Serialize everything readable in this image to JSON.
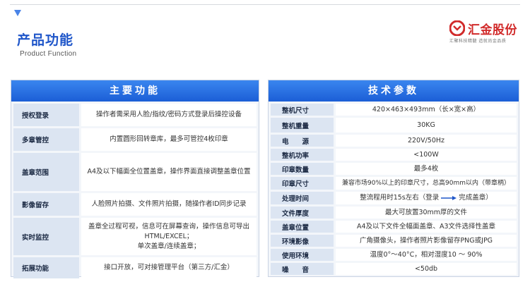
{
  "header": {
    "title": "产品功能",
    "subtitle": "Product Function"
  },
  "logo": {
    "name": "汇金股份",
    "tagline": "汇聚科技精髓   造就尚金品质"
  },
  "main_functions": {
    "heading": "主要功能",
    "rows": [
      {
        "label": "授权登录",
        "lines": [
          "操作者需采用人脸/指纹/密码方式登录后操控设备"
        ]
      },
      {
        "label": "多章管控",
        "lines": [
          "内置圆形回转章库，最多可管控4枚印章"
        ]
      },
      {
        "label": "盖章范围",
        "lines": [
          "A4及以下幅面全位置盖章，操作界面直接调整盖章位置"
        ]
      },
      {
        "label": "影像留存",
        "lines": [
          "人脸照片拍摄、文件照片拍摄，随操作者ID同步记录"
        ]
      },
      {
        "label": "实时监控",
        "lines": [
          "盖章全过程可视，信息可在屏幕查询，操作信息可导出",
          "HTML/EXCEL；",
          "单次盖章/连续盖章；"
        ]
      },
      {
        "label": "拓展功能",
        "lines": [
          "接口开放，可对接管理平台（第三方/汇金）"
        ]
      }
    ]
  },
  "tech_params": {
    "heading": "技术参数",
    "rows": [
      {
        "label": "整机尺寸",
        "value": "420×463×493mm（长×宽×高）"
      },
      {
        "label": "整机重量",
        "value": "30KG"
      },
      {
        "label": "电　　源",
        "value": "220V/50Hz"
      },
      {
        "label": "整机功率",
        "value": "<100W"
      },
      {
        "label": "印章数量",
        "value": "最多4枚"
      },
      {
        "label": "印章尺寸",
        "value": "兼容市场90%以上的印章尺寸，总高90mm以内（带章柄）"
      },
      {
        "label": "处理时间",
        "value_before": "整流程用时15s左右（登录",
        "value_after": "完成盖章）"
      },
      {
        "label": "文件厚度",
        "value": "最大可放置30mm厚的文件"
      },
      {
        "label": "盖章位置",
        "value": "A4及以下文件全幅面盖章、A3文件选择性盖章"
      },
      {
        "label": "环境影像",
        "value": "广角摄像头，操作者照片影像留存PNG或JPG"
      },
      {
        "label": "使用环境",
        "value": "温度0°～40°C，相对湿度10 ～ 90%"
      },
      {
        "label": "噪　　音",
        "value": "<50db"
      }
    ]
  },
  "colors": {
    "accent_blue": "#1f56c9",
    "band_blue": "#2a6fe3",
    "label_bg": "#dce5f2",
    "brand_red": "#d12a2a"
  }
}
